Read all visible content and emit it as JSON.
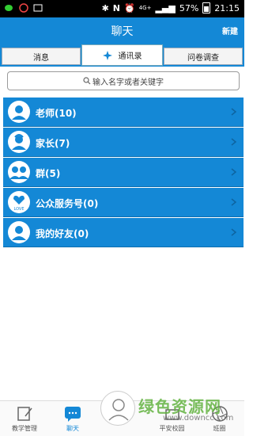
{
  "status_bar": {
    "battery": "57%",
    "time": "21:15",
    "network": "4G+"
  },
  "header": {
    "title": "聊天",
    "new_label": "新建"
  },
  "tabs": [
    {
      "label": "消息"
    },
    {
      "label": "通讯录"
    },
    {
      "label": "问卷调查"
    }
  ],
  "search": {
    "placeholder": "输入名字或者关键字"
  },
  "contacts": [
    {
      "label": "老师(10)",
      "icon": "teacher-icon"
    },
    {
      "label": "家长(7)",
      "icon": "parent-icon"
    },
    {
      "label": "群(5)",
      "icon": "group-icon"
    },
    {
      "label": "公众服务号(0)",
      "icon": "love-icon"
    },
    {
      "label": "我的好友(0)",
      "icon": "friend-icon"
    }
  ],
  "bottom_nav": [
    {
      "label": "教学管理"
    },
    {
      "label": "聊天"
    },
    {
      "label": "平安校园"
    },
    {
      "label": "班圈"
    }
  ],
  "watermark": {
    "text": "绿色资源网",
    "url": "www.downcc.com"
  },
  "colors": {
    "accent": "#1488d6"
  }
}
